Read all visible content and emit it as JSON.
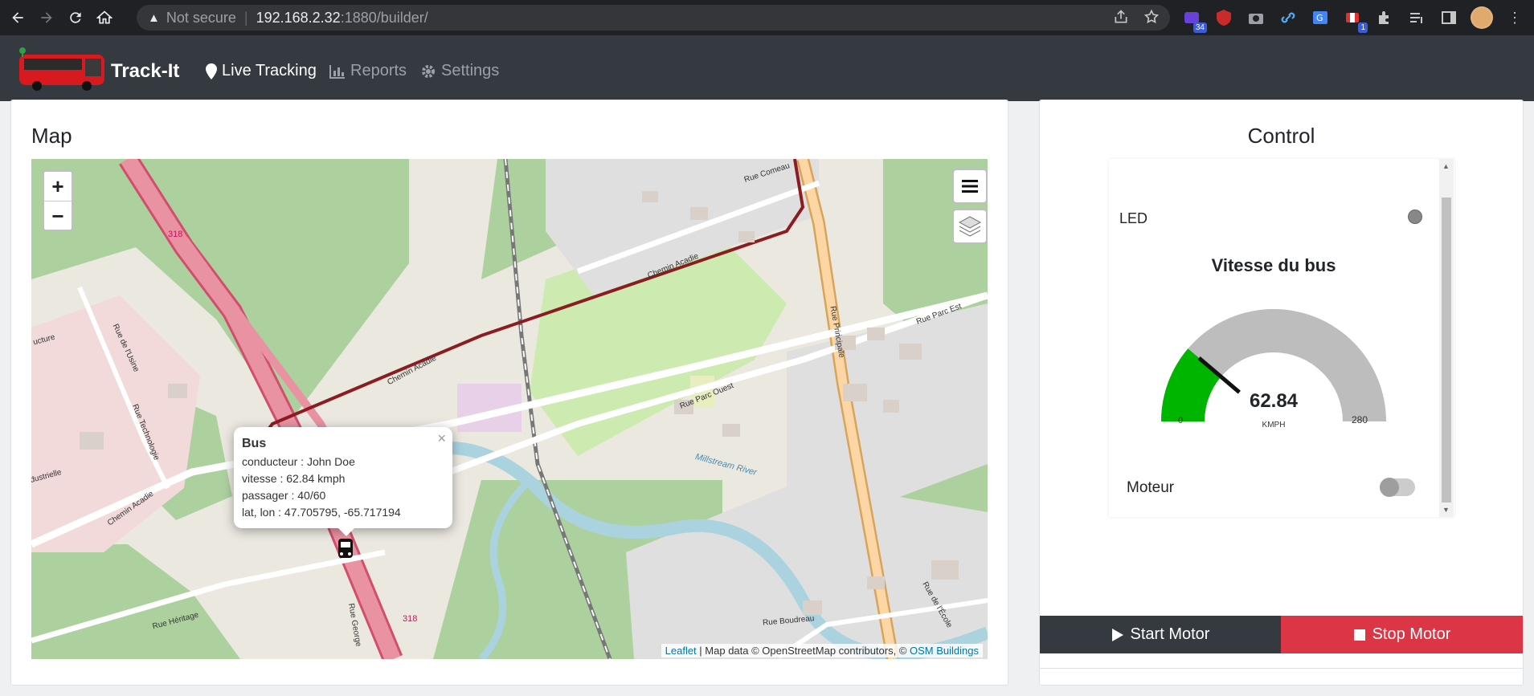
{
  "browser": {
    "security_label": "Not secure",
    "url_host": "192.168.2.32",
    "url_path": ":1880/builder/",
    "badge_34": "34",
    "badge_1": "1"
  },
  "app": {
    "brand": "Track-It",
    "nav": [
      {
        "label": "Live Tracking",
        "icon": "map-marker-icon",
        "active": true
      },
      {
        "label": "Reports",
        "icon": "bar-chart-icon",
        "active": false
      },
      {
        "label": "Settings",
        "icon": "gear-icon",
        "active": false
      }
    ]
  },
  "map_panel": {
    "title": "Map",
    "zoom_in": "+",
    "zoom_out": "−",
    "popup": {
      "title": "Bus",
      "lines": [
        "conducteur : John Doe",
        "vitesse : 62.84 kmph",
        "passager : 40/60",
        "lat, lon : 47.705795, -65.717194"
      ],
      "close": "×"
    },
    "labels": {
      "rue_comeau": "Rue Comeau",
      "chemin_acadie_1": "Chemin Acadie",
      "chemin_acadie_2": "Chemin Acadie",
      "chemin_acadie_3": "Chemin Acadie",
      "rue_principale": "Rue Principale",
      "rue_parc_est": "Rue Parc Est",
      "rue_parc_ouest": "Rue Parc Ouest",
      "millstream": "Millstream River",
      "rue_usine": "Rue de l'Usine",
      "rue_techno": "Rue Technologie",
      "rue_heritage": "Rue Héritage",
      "rue_george": "Rue George",
      "rue_boudreau": "Rue Boudreau",
      "rue_ecole": "Rue de l'École",
      "route_318_a": "318",
      "route_318_b": "318",
      "ucture": "ucture",
      "dustrielle": "dustrielle"
    },
    "attribution": {
      "leaflet": "Leaflet",
      "middle": " | Map data © OpenStreetMap contributors, © ",
      "osm": "OSM Buildings"
    }
  },
  "control_panel": {
    "title": "Control",
    "led_label": "LED",
    "gauge": {
      "title": "Vitesse du bus",
      "value": "62.84",
      "value_num": 62.84,
      "unit": "KMPH",
      "min": "0",
      "max": "280",
      "min_num": 0,
      "max_num": 280,
      "fill_color": "#00b500",
      "track_color": "#bdbdbd"
    },
    "moteur_label": "Moteur",
    "moteur_on": false,
    "start_label": "Start Motor",
    "stop_label": "Stop Motor",
    "colors": {
      "start": "#343a40",
      "stop": "#dc3545"
    }
  }
}
